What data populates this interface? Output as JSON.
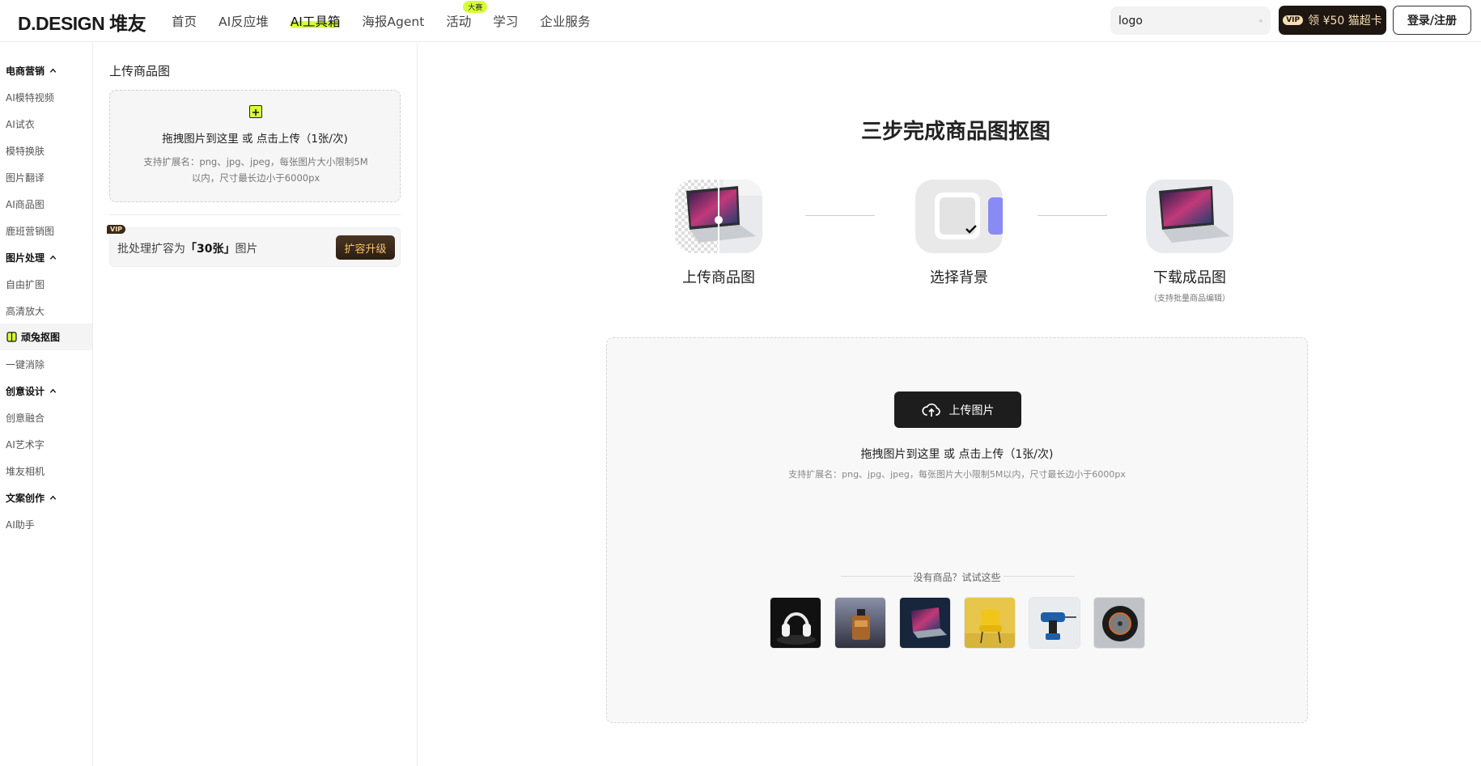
{
  "header": {
    "logo": "D.DESIGN 堆友",
    "nav": [
      {
        "label": "首页",
        "active": false,
        "badge": ""
      },
      {
        "label": "AI反应堆",
        "active": false,
        "badge": ""
      },
      {
        "label": "AI工具箱",
        "active": true,
        "badge": ""
      },
      {
        "label": "海报Agent",
        "active": false,
        "badge": ""
      },
      {
        "label": "活动",
        "active": false,
        "badge": "大赛"
      },
      {
        "label": "学习",
        "active": false,
        "badge": ""
      },
      {
        "label": "企业服务",
        "active": false,
        "badge": ""
      }
    ],
    "search_value": "logo",
    "vip_badge": "VIP",
    "vip_label": "领 ¥50 猫超卡",
    "login_label": "登录/注册",
    "accent_color": "#d7ff3a"
  },
  "sidebar": {
    "groups": [
      {
        "title": "电商营销",
        "items": [
          "AI模特视频",
          "AI试衣",
          "模特换肤",
          "图片翻译",
          "AI商品图",
          "鹿班营销图"
        ]
      },
      {
        "title": "图片处理",
        "items": [
          "自由扩图",
          "高清放大",
          "顽兔抠图",
          "一键消除"
        ]
      },
      {
        "title": "创意设计",
        "items": [
          "创意融合",
          "AI艺术字",
          "堆友相机"
        ]
      },
      {
        "title": "文案创作",
        "items": [
          "AI助手"
        ]
      }
    ],
    "active_item": "顽兔抠图"
  },
  "panel": {
    "title": "上传商品图",
    "drop_main": "拖拽图片到这里 或 点击上传（1张/次)",
    "drop_sub": "支持扩展名：png、jpg、jpeg，每张图片大小限制5M以内，尺寸最长边小于6000px",
    "vip_tag": "VIP",
    "batch_prefix": "批处理扩容为",
    "batch_highlight": "「30张」",
    "batch_suffix": "图片",
    "upgrade_label": "扩容升级"
  },
  "main": {
    "title": "三步完成商品图抠图",
    "steps": [
      {
        "label": "上传商品图",
        "note": ""
      },
      {
        "label": "选择背景",
        "note": ""
      },
      {
        "label": "下载成品图",
        "note": "（支持批量商品编辑）"
      }
    ],
    "upload_button": "上传图片",
    "upload_main": "拖拽图片到这里 或 点击上传（1张/次)",
    "upload_sub": "支持扩展名：png、jpg、jpeg，每张图片大小限制5M以内，尺寸最长边小于6000px",
    "try_text": "没有商品？试试这些",
    "samples": [
      "headphones-sample",
      "perfume-sample",
      "laptop-sample",
      "chair-sample",
      "drill-sample",
      "tire-sample"
    ]
  }
}
